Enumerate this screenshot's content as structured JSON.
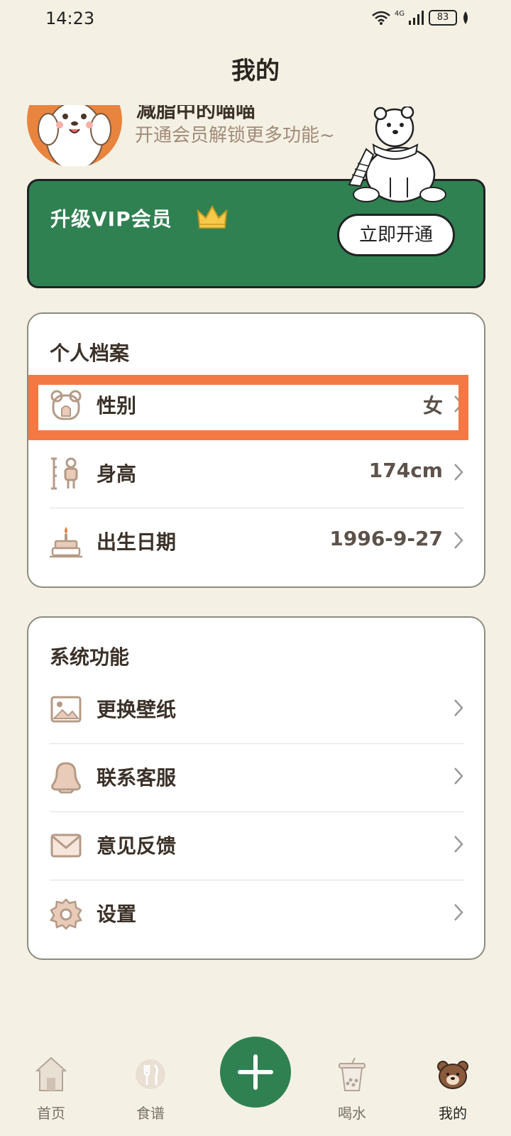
{
  "status_bar": {
    "time": "14:23",
    "network": "4G",
    "battery": "83"
  },
  "header": {
    "title": "我的"
  },
  "profile": {
    "nickname": "减脂中的喵喵",
    "subtitle": "开通会员解锁更多功能~"
  },
  "vip": {
    "title": "升级VIP会员",
    "button": "立即开通"
  },
  "personal_profile": {
    "title": "个人档案",
    "items": [
      {
        "label": "性别",
        "value": "女",
        "icon": "bear-gender-icon"
      },
      {
        "label": "身高",
        "value": "174cm",
        "icon": "height-ruler-icon"
      },
      {
        "label": "出生日期",
        "value": "1996-9-27",
        "icon": "birthday-cake-icon"
      }
    ]
  },
  "system": {
    "title": "系统功能",
    "items": [
      {
        "label": "更换壁纸",
        "icon": "image-icon"
      },
      {
        "label": "联系客服",
        "icon": "penguin-icon"
      },
      {
        "label": "意见反馈",
        "icon": "mail-icon"
      },
      {
        "label": "设置",
        "icon": "gear-icon"
      }
    ]
  },
  "tabbar": {
    "items": [
      {
        "label": "首页",
        "icon": "house-icon"
      },
      {
        "label": "食谱",
        "icon": "cutlery-icon"
      },
      {
        "label": "喝水",
        "icon": "drink-cup-icon"
      },
      {
        "label": "我的",
        "icon": "bear-face-icon"
      }
    ]
  },
  "colors": {
    "background": "#f4f1e4",
    "accent_green": "#2f8152",
    "highlight": "#f47843",
    "icon_brown": "#b59a86"
  }
}
